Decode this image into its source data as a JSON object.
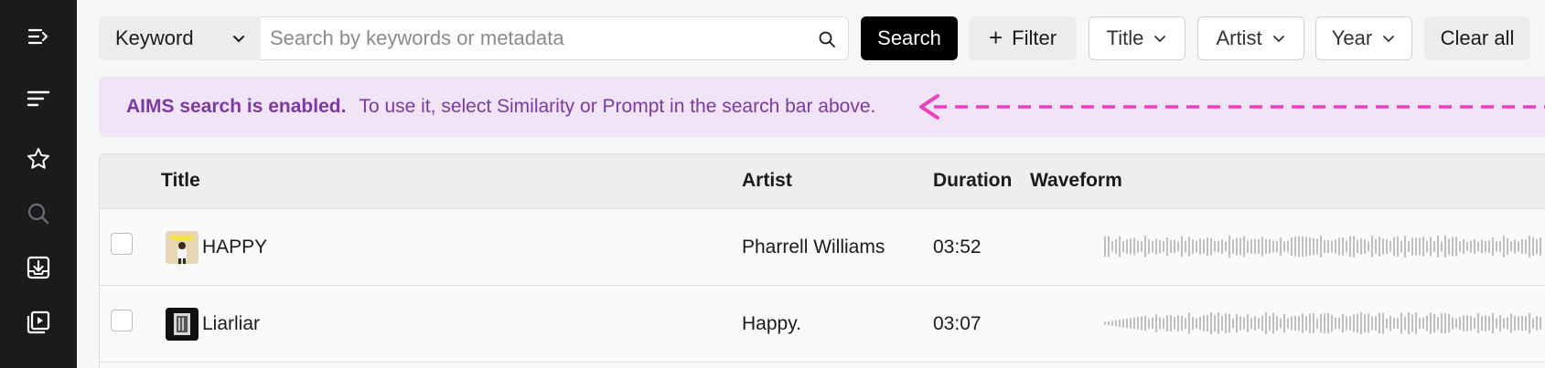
{
  "sidebar": {
    "items": [
      {
        "icon": "collapse-menu-icon"
      },
      {
        "icon": "sort-lines-icon"
      },
      {
        "icon": "star-icon"
      },
      {
        "icon": "search-icon"
      },
      {
        "icon": "inbox-download-icon"
      },
      {
        "icon": "playlist-play-icon"
      }
    ]
  },
  "search": {
    "mode": "Keyword",
    "placeholder": "Search by keywords or metadata",
    "value": "",
    "search_label": "Search",
    "filter_label": "Filter",
    "filters": [
      "Title",
      "Artist",
      "Year"
    ],
    "clear_label": "Clear all"
  },
  "banner": {
    "bold": "AIMS search is enabled.",
    "text": "To use it, select Similarity or Prompt in the search bar above.",
    "arrow_color": "#ee3fbe"
  },
  "table": {
    "columns": [
      "Title",
      "Artist",
      "Duration",
      "Waveform"
    ],
    "rows": [
      {
        "title": "HAPPY",
        "artist": "Pharrell Williams",
        "duration": "03:52"
      },
      {
        "title": "Liarliar",
        "artist": "Happy.",
        "duration": "03:07"
      }
    ]
  },
  "colors": {
    "sidebar_bg": "#1b1b1d",
    "banner_bg": "#f1e4f6",
    "banner_text": "#7b3aa0",
    "primary_button": "#000000"
  }
}
